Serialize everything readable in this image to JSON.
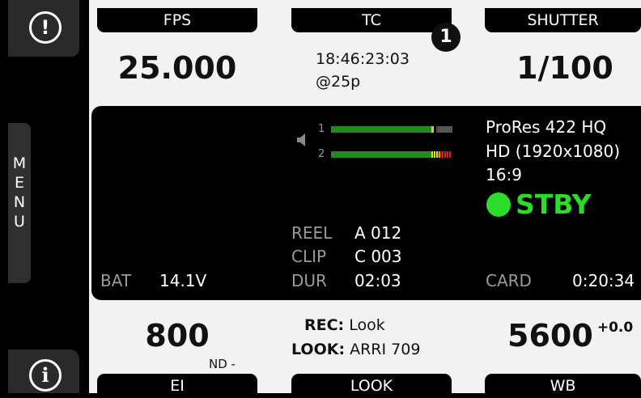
{
  "left_rail": {
    "warning_symbol": "!",
    "menu_label": "MENU",
    "menu_letters": [
      "M",
      "E",
      "N",
      "U"
    ],
    "info_symbol": "i"
  },
  "top": {
    "fps": {
      "label": "FPS",
      "value": "25.000"
    },
    "tc": {
      "label": "TC",
      "time": "18:46:23:03",
      "rate": "@25p",
      "callout": "1"
    },
    "shutter": {
      "label": "SHUTTER",
      "value": "1/100"
    }
  },
  "monitor": {
    "codec": "ProRes 422 HQ",
    "resolution": "HD (1920x1080)",
    "aspect": "16:9",
    "status": "STBY",
    "status_color": "#2bdc2b",
    "audio": {
      "ch1": "1",
      "ch2": "2"
    },
    "reel_label": "REEL",
    "reel_value": "A 012",
    "clip_label": "CLIP",
    "clip_value": "C 003",
    "dur_label": "DUR",
    "dur_value": "02:03",
    "bat_label": "BAT",
    "bat_value": "14.1V",
    "card_label": "CARD",
    "card_value": "0:20:34"
  },
  "bottom": {
    "ei": {
      "label": "EI",
      "value": "800",
      "nd": "ND -"
    },
    "look": {
      "label": "LOOK",
      "rec_label": "REC:",
      "rec_value": "Look",
      "look_label": "LOOK:",
      "look_value": "ARRI 709"
    },
    "wb": {
      "label": "WB",
      "value": "5600",
      "tint": "+0.0"
    }
  }
}
